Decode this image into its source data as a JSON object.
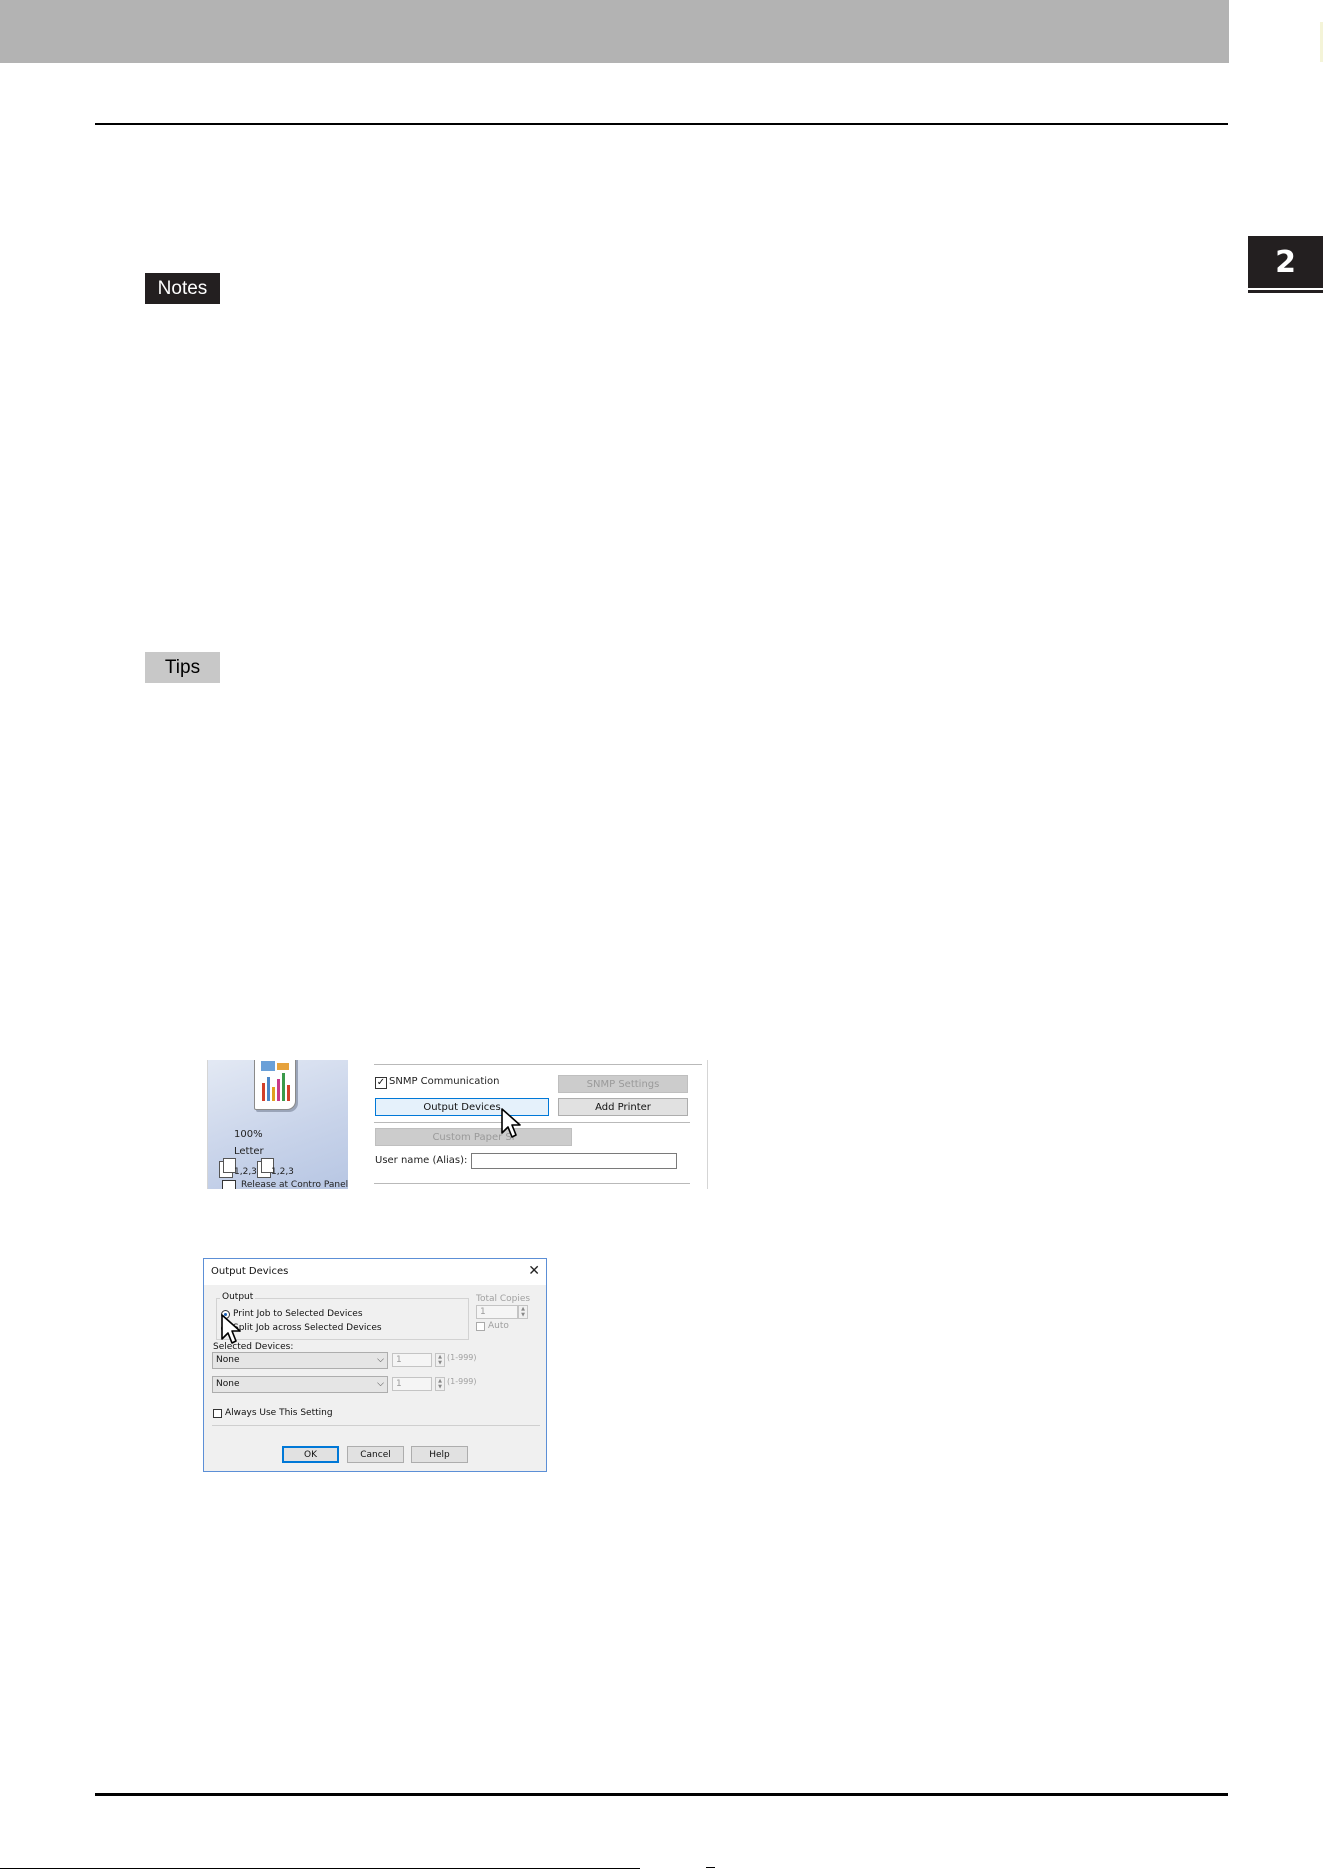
{
  "page": {
    "chapter_number": "2",
    "notes_label": "Notes",
    "tips_label": "Tips"
  },
  "screenshot1": {
    "preview": {
      "zoom": "100%",
      "paper": "Letter",
      "collate_left": "1,2,3",
      "collate_right": "1,2,3",
      "release": "Release at Contro Panel"
    },
    "snmp_checkbox_label": "SNMP Communication",
    "snmp_checked": true,
    "snmp_settings_button": "SNMP Settings",
    "output_devices_button": "Output Devices",
    "add_printer_button": "Add Printer",
    "custom_paper_button": "Custom Paper Si",
    "user_name_label": "User name (Alias):",
    "user_name_value": ""
  },
  "dialog": {
    "title": "Output Devices",
    "close_glyph": "✕",
    "output_group_label": "Output",
    "radio_print_label": "Print Job to Selected Devices",
    "radio_split_label": "Split Job across Selected Devices",
    "total_copies_label": "Total Copies",
    "total_copies_value": "1",
    "auto_label": "Auto",
    "selected_devices_label": "Selected Devices:",
    "devices": [
      {
        "name": "None",
        "copies": "1",
        "range": "(1-999)"
      },
      {
        "name": "None",
        "copies": "1",
        "range": "(1-999)"
      }
    ],
    "always_use_label": "Always Use This Setting",
    "ok_button": "OK",
    "cancel_button": "Cancel",
    "help_button": "Help"
  },
  "colors": {
    "header_bar": "#b3b3b3",
    "notes_bg": "#231f20",
    "tips_bg": "#c8c8c8",
    "accent": "#0078d7"
  }
}
